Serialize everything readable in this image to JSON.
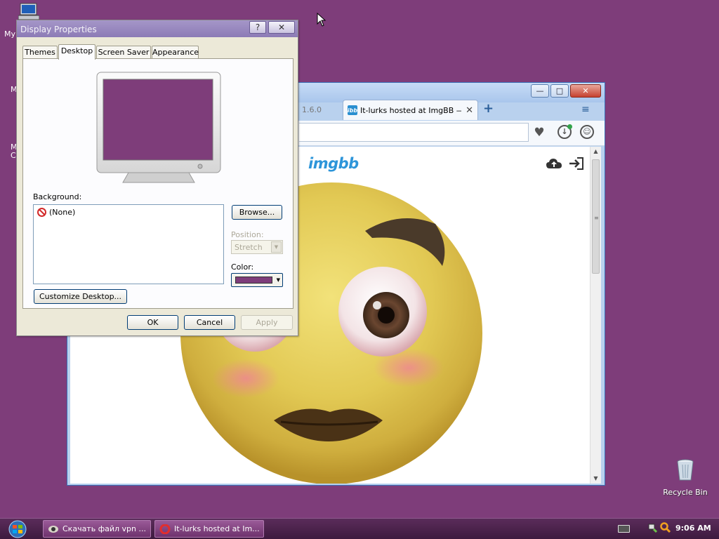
{
  "desktop": {
    "bg_color": "#7e3d7a",
    "my_computer_label": "My",
    "frag_1": "M",
    "frag_2": "M",
    "frag_3": "C",
    "recycle_label": "Recycle Bin"
  },
  "browser": {
    "min_label": "—",
    "max_label": "□",
    "close_label": "✕",
    "old_tab_text": "1.6.0",
    "active_tab_favicon": "ibb",
    "active_tab_title": "It-lurks hosted at ImgBB —",
    "tab_close": "✕",
    "new_tab": "+",
    "tab_list": "≡",
    "heart": "♥",
    "download": "↓",
    "account": "☺",
    "logo": "imgbb",
    "accent": "#2d95d9"
  },
  "dialog": {
    "title": "Display Properties",
    "help": "?",
    "close": "✕",
    "tabs": {
      "themes": "Themes",
      "desktop": "Desktop",
      "screen_saver": "Screen Saver",
      "appearance": "Appearance"
    },
    "background_label": "Background:",
    "background_items": [
      {
        "label": "(None)"
      }
    ],
    "browse": "Browse...",
    "position_label": "Position:",
    "position_value": "Stretch",
    "color_label": "Color:",
    "color_value": "#7e3d7a",
    "customize": "Customize Desktop...",
    "ok": "OK",
    "cancel": "Cancel",
    "apply": "Apply"
  },
  "taskbar": {
    "items": [
      {
        "label": "Скачать файл vpn ..."
      },
      {
        "label": "It-lurks hosted at Im..."
      }
    ],
    "clock": "9:06 AM"
  }
}
